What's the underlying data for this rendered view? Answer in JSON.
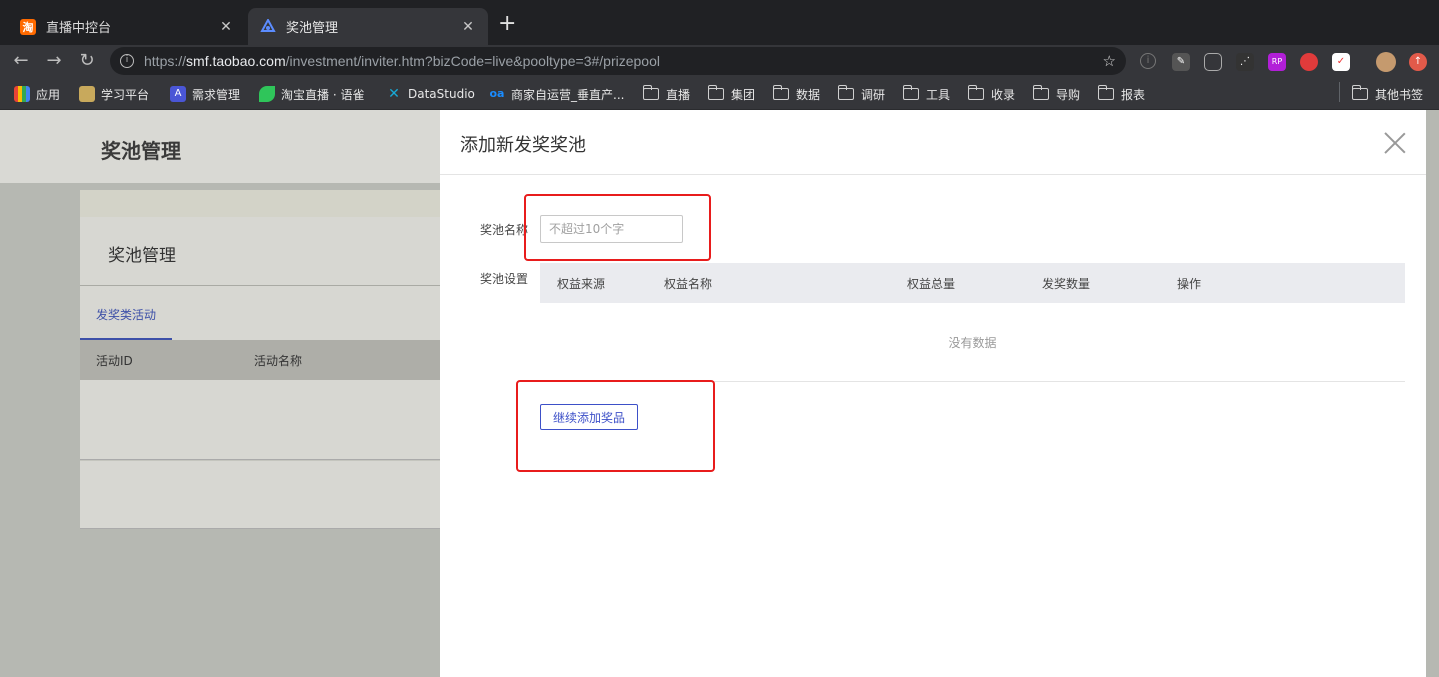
{
  "browser": {
    "tabs": [
      {
        "title": "直播中控台",
        "favicon": "taobao-favicon-icon",
        "favicon_text": "淘"
      },
      {
        "title": "奖池管理",
        "favicon": "app-logo-icon"
      }
    ],
    "url_scheme": "https://",
    "url_host": "smf.taobao.com",
    "url_path": "/investment/inviter.htm?bizCode=live&pooltype=3#/prizepool",
    "bookmarks": [
      {
        "label": "应用",
        "icon": "apps-grid-icon"
      },
      {
        "label": "学习平台",
        "icon": "bookmark-favicon-icon"
      },
      {
        "label": "需求管理",
        "icon": "bookmark-favicon-icon",
        "icon_text": "A"
      },
      {
        "label": "淘宝直播 · 语雀",
        "icon": "yuque-icon"
      },
      {
        "label": "DataStudio",
        "icon": "datastudio-icon"
      },
      {
        "label": "商家自运营_垂直产...",
        "icon": "bookmark-favicon-icon"
      },
      {
        "label": "直播",
        "icon": "folder-icon"
      },
      {
        "label": "集团",
        "icon": "folder-icon"
      },
      {
        "label": "数据",
        "icon": "folder-icon"
      },
      {
        "label": "调研",
        "icon": "folder-icon"
      },
      {
        "label": "工具",
        "icon": "folder-icon"
      },
      {
        "label": "收录",
        "icon": "folder-icon"
      },
      {
        "label": "导购",
        "icon": "folder-icon"
      },
      {
        "label": "报表",
        "icon": "folder-icon"
      }
    ],
    "other_bookmarks": "其他书签",
    "accent": "#3d50c8"
  },
  "page": {
    "header_title": "奖池管理",
    "card_title": "奖池管理",
    "tab_active": "发奖类活动",
    "table_columns": [
      "活动ID",
      "活动名称"
    ]
  },
  "drawer": {
    "title": "添加新发奖奖池",
    "name_label": "奖池名称",
    "name_placeholder": "不超过10个字",
    "settings_label": "奖池设置",
    "columns": [
      "权益来源",
      "权益名称",
      "权益总量",
      "发奖数量",
      "操作"
    ],
    "empty_text": "没有数据",
    "add_button": "继续添加奖品"
  }
}
